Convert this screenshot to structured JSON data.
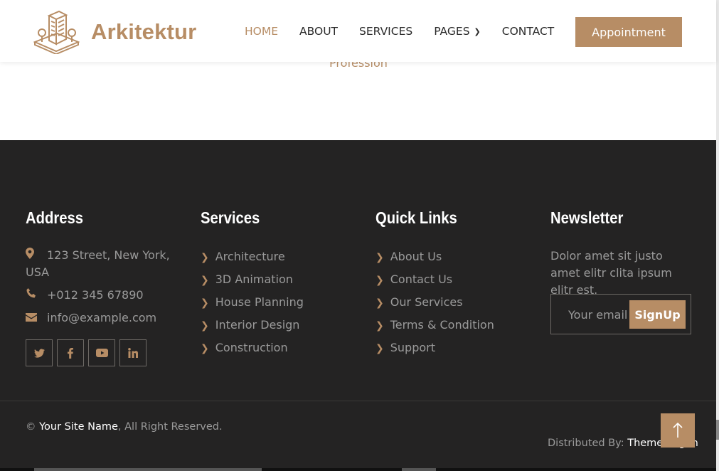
{
  "brand": {
    "name": "Arkitektur",
    "logo_icon": "building-logo-icon"
  },
  "nav": {
    "items": [
      {
        "label": "HOME",
        "active": true
      },
      {
        "label": "ABOUT",
        "active": false
      },
      {
        "label": "SERVICES",
        "active": false
      },
      {
        "label": "PAGES",
        "active": false,
        "dropdown": true
      },
      {
        "label": "CONTACT",
        "active": false
      }
    ],
    "cta": "Appointment"
  },
  "hero": {
    "profession": "Profession"
  },
  "footer": {
    "address": {
      "title": "Address",
      "street": "123 Street, New York, USA",
      "phone": "+012 345 67890",
      "email": "info@example.com",
      "socials": [
        "twitter-icon",
        "facebook-icon",
        "youtube-icon",
        "linkedin-icon"
      ]
    },
    "services": {
      "title": "Services",
      "items": [
        "Architecture",
        "3D Animation",
        "House Planning",
        "Interior Design",
        "Construction"
      ]
    },
    "quick_links": {
      "title": "Quick Links",
      "items": [
        "About Us",
        "Contact Us",
        "Our Services",
        "Terms & Condition",
        "Support"
      ]
    },
    "newsletter": {
      "title": "Newsletter",
      "text": "Dolor amet sit justo amet elitr clita ipsum elitr est.",
      "placeholder": "Your email",
      "button": "SignUp"
    },
    "copyright": {
      "symbol": "©",
      "site_name": "Your Site Name",
      "rights": ", All Right Reserved."
    },
    "distributed": {
      "label": "Distributed By: ",
      "name": "ThemeWagon"
    }
  },
  "colors": {
    "accent": "#b78d65",
    "footer_bg": "#242323",
    "muted": "#9a9a9a"
  }
}
